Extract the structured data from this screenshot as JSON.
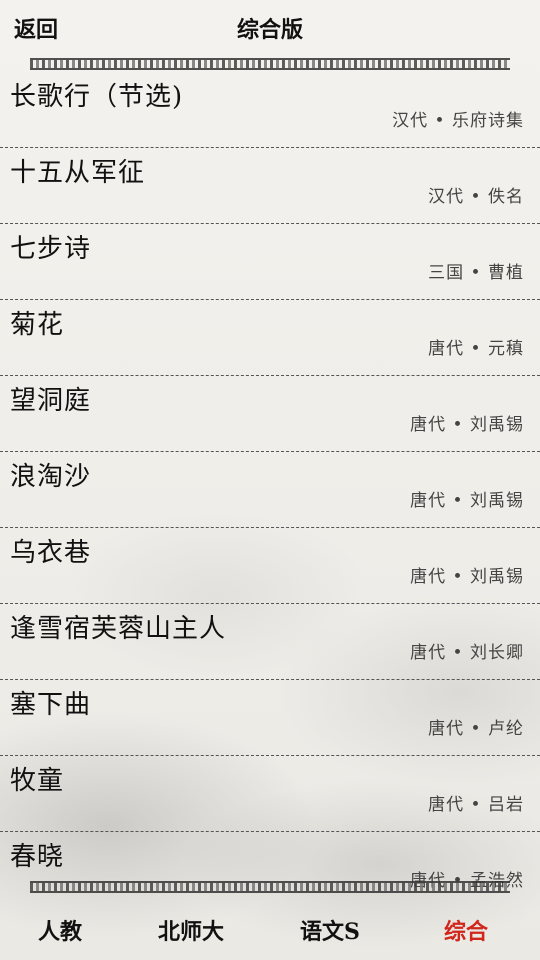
{
  "header": {
    "back_label": "返回",
    "title": "综合版"
  },
  "poems": [
    {
      "title": "长歌行（节选)",
      "meta": "汉代 • 乐府诗集"
    },
    {
      "title": "十五从军征",
      "meta": "汉代 • 佚名"
    },
    {
      "title": "七步诗",
      "meta": "三国 • 曹植"
    },
    {
      "title": "菊花",
      "meta": "唐代 • 元稹"
    },
    {
      "title": "望洞庭",
      "meta": "唐代 • 刘禹锡"
    },
    {
      "title": "浪淘沙",
      "meta": "唐代 • 刘禹锡"
    },
    {
      "title": "乌衣巷",
      "meta": "唐代 • 刘禹锡"
    },
    {
      "title": "逢雪宿芙蓉山主人",
      "meta": "唐代 • 刘长卿"
    },
    {
      "title": "塞下曲",
      "meta": "唐代 • 卢纶"
    },
    {
      "title": "牧童",
      "meta": "唐代 • 吕岩"
    },
    {
      "title": "春晓",
      "meta": "唐代 • 孟浩然"
    }
  ],
  "tabs": [
    {
      "label": "人教"
    },
    {
      "label": "北师大"
    },
    {
      "label": "语文S"
    },
    {
      "label": "综合"
    }
  ],
  "colors": {
    "active_tab": "#d1261c",
    "text": "#111111"
  }
}
